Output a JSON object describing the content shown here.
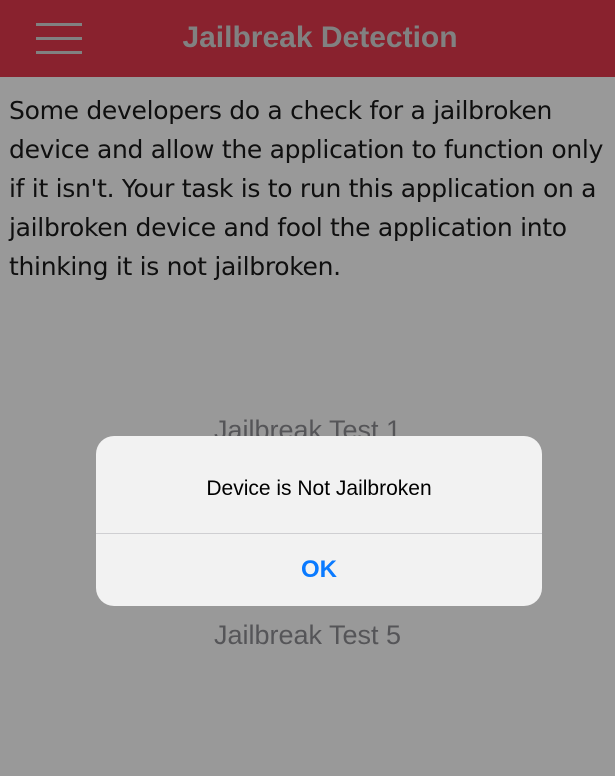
{
  "navbar": {
    "title": "Jailbreak Detection",
    "menu_icon": "hamburger-menu-icon",
    "background_color": "#e53a4e"
  },
  "intro_text": "Some developers do a check for a jailbroken device and allow the application to function only if it isn't. Your task is to run this application on a jailbroken device and fool the application into thinking it is not jailbroken.",
  "tests": [
    {
      "label": "Jailbreak Test 1"
    },
    {
      "label": "Jailbreak Test 5"
    }
  ],
  "alert": {
    "message": "Device is Not Jailbroken",
    "ok_label": "OK"
  },
  "colors": {
    "accent": "#0a7aff",
    "overlay": "rgba(0,0,0,0.4)"
  }
}
